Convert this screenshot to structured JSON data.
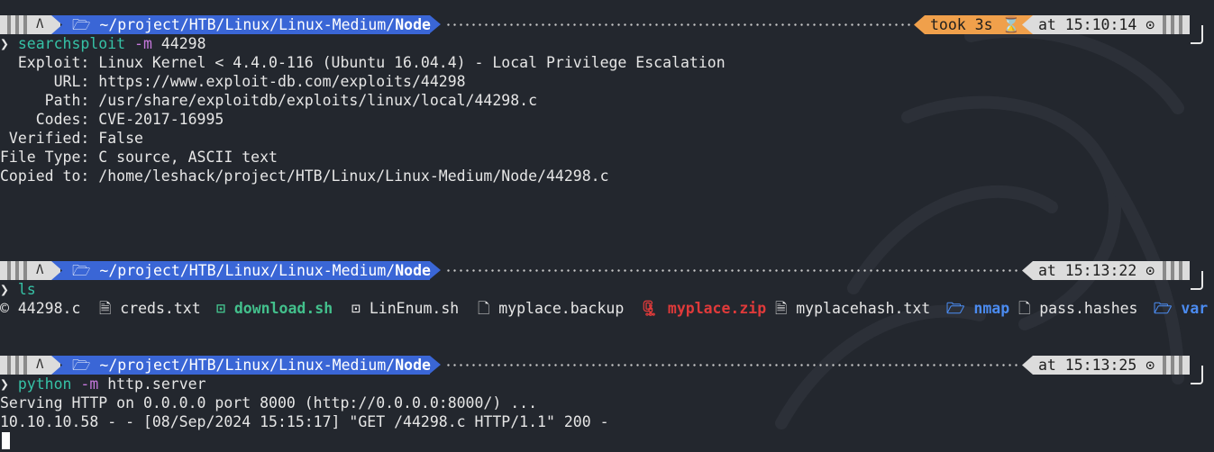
{
  "prompt": {
    "os_glyph": "Λ",
    "folder_glyph": "🗁",
    "path_prefix": "~/project/HTB/Linux/Linux-Medium/",
    "path_leaf": "Node",
    "arrow": "❯"
  },
  "block1": {
    "took": "took 3s ⌛",
    "time": "at 15:10:14 ⊙",
    "command": "searchsploit",
    "flag": "-m",
    "arg": "44298",
    "output": [
      "  Exploit: Linux Kernel < 4.4.0-116 (Ubuntu 16.04.4) - Local Privilege Escalation",
      "      URL: https://www.exploit-db.com/exploits/44298",
      "     Path: /usr/share/exploitdb/exploits/linux/local/44298.c",
      "    Codes: CVE-2017-16995",
      " Verified: False",
      "File Type: C source, ASCII text",
      "Copied to: /home/leshack/project/HTB/Linux/Linux-Medium/Node/44298.c"
    ]
  },
  "block2": {
    "time": "at 15:13:22 ⊙",
    "command": "ls",
    "files": [
      {
        "icon": "c-file-icon",
        "glyph": "©",
        "name": "44298.c",
        "kind": "plain"
      },
      {
        "icon": "text-file-icon",
        "glyph": "🗎",
        "name": "creds.txt",
        "kind": "plain"
      },
      {
        "icon": "script-icon",
        "glyph": "⊡",
        "name": "download.sh",
        "kind": "exec"
      },
      {
        "icon": "script-icon",
        "glyph": "⊡",
        "name": "LinEnum.sh",
        "kind": "plain"
      },
      {
        "icon": "file-icon",
        "glyph": "🗋",
        "name": "myplace.backup",
        "kind": "plain"
      },
      {
        "icon": "zip-icon",
        "glyph": "🗜",
        "name": "myplace.zip",
        "kind": "zip"
      },
      {
        "icon": "text-file-icon",
        "glyph": "🗎",
        "name": "myplacehash.txt",
        "kind": "plain"
      },
      {
        "icon": "folder-icon",
        "glyph": "🗁",
        "name": "nmap",
        "kind": "dir"
      },
      {
        "icon": "file-icon",
        "glyph": "🗋",
        "name": "pass.hashes",
        "kind": "plain"
      },
      {
        "icon": "folder-icon",
        "glyph": "🗁",
        "name": "var",
        "kind": "dir"
      }
    ]
  },
  "block3": {
    "time": "at 15:13:25 ⊙",
    "command": "python",
    "flag": "-m",
    "arg": "http.server",
    "output": [
      "Serving HTTP on 0.0.0.0 port 8000 (http://0.0.0.0:8000/) ...",
      "10.10.10.58 - - [08/Sep/2024 15:15:17] \"GET /44298.c HTTP/1.1\" 200 -"
    ]
  },
  "colors": {
    "background": "#23272e",
    "path_segment": "#3a66d6",
    "took_segment": "#f0a04b",
    "command": "#36c2a6",
    "flag": "#c678dd",
    "exec_file": "#43c08c",
    "zip_file": "#e03a3a",
    "dir": "#4b8bf0"
  }
}
